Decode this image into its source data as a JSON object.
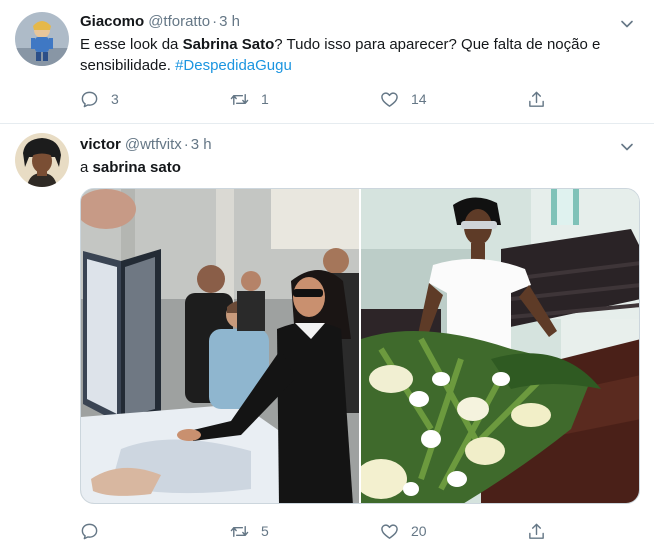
{
  "tweets": [
    {
      "name": "Giacomo",
      "handle": "@tforatto",
      "separator": "·",
      "time": "3 h",
      "text": {
        "t1": "E esse look da ",
        "bold1": "Sabrina Sato",
        "t2": "? Tudo isso para aparecer? Que falta de noção e sensibilidade. ",
        "hashtag": "#DespedidaGugu"
      },
      "actions": {
        "replies": "3",
        "retweets": "1",
        "likes": "14"
      }
    },
    {
      "name": "victor",
      "handle": "@wtfvitx",
      "separator": "·",
      "time": "3 h",
      "text": {
        "t1": "a ",
        "bold1": "sabrina sato"
      },
      "actions": {
        "replies": "",
        "retweets": "5",
        "likes": "20"
      }
    }
  ],
  "icons": {
    "reply": "reply-icon",
    "retweet": "retweet-icon",
    "like": "heart-icon",
    "share": "share-icon",
    "more": "chevron-down-icon"
  },
  "colors": {
    "hashtag": "#1b95e0",
    "muted": "#657786",
    "divider": "#e6ecf0"
  }
}
